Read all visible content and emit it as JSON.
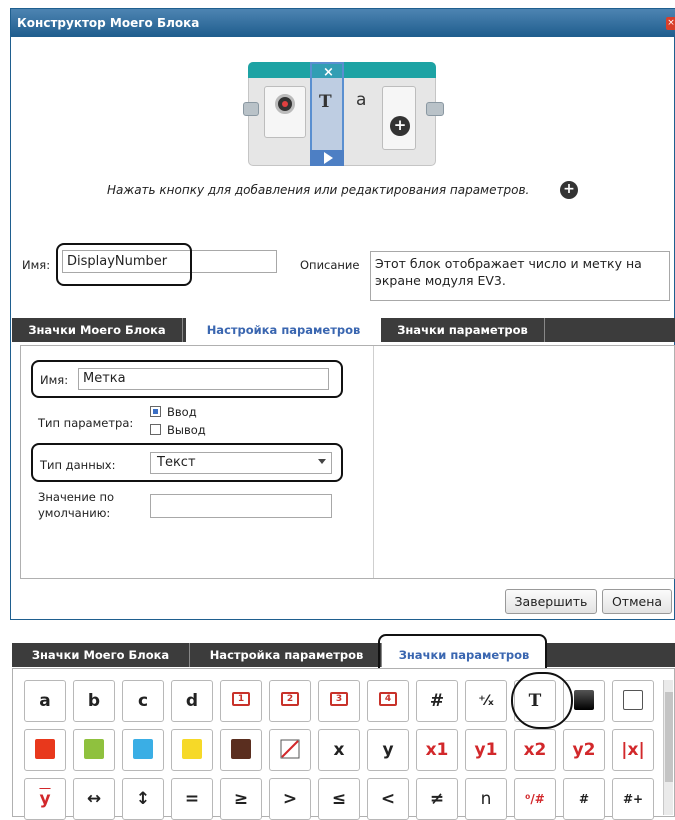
{
  "dialog": {
    "title": "Конструктор Моего Блока",
    "close_glyph": "×",
    "block": {
      "text_param": "T",
      "label_param": "a",
      "remove_glyph": "×",
      "add_glyph": "+"
    },
    "hint": "Нажать кнопку для добавления или редактирования параметров.",
    "hint_add_glyph": "+",
    "name_label": "Имя:",
    "name_value": "DisplayNumber",
    "desc_label": "Описание",
    "desc_value": "Этот блок отображает число и метку на экране модуля EV3.",
    "tabs": [
      {
        "label": "Значки Моего Блока"
      },
      {
        "label": "Настройка параметров"
      },
      {
        "label": "Значки параметров"
      }
    ],
    "settings": {
      "name_label": "Имя:",
      "name_value": "Метка",
      "type_label": "Тип параметра:",
      "type_input": "Ввод",
      "type_output": "Вывод",
      "datatype_label": "Тип данных:",
      "datatype_value": "Текст",
      "default_label_1": "Значение по",
      "default_label_2": "умолчанию:",
      "default_value": ""
    },
    "finish_button": "Завершить",
    "cancel_button": "Отмена"
  },
  "lower_tabs": [
    {
      "label": "Значки Моего Блока"
    },
    {
      "label": "Настройка параметров"
    },
    {
      "label": "Значки параметров"
    }
  ],
  "icon_grid": {
    "row1": [
      "a",
      "b",
      "c",
      "d",
      "1",
      "2",
      "3",
      "4",
      "#",
      "⁺⁄ₓ",
      "T",
      "",
      ""
    ],
    "row2_colors": [
      "#e8381c",
      "#8fc13e",
      "#3aaee5",
      "#f6d928",
      "#5a2e1f"
    ],
    "row2_text": [
      "x",
      "y",
      "x1",
      "y1",
      "x2",
      "y2",
      "|x|"
    ],
    "row3": [
      "y",
      "↔",
      "↕",
      "=",
      "≥",
      ">",
      "≤",
      "<",
      "≠",
      "n",
      "⁰/#",
      "#",
      "#+"
    ]
  },
  "colors": {
    "title_bar": "#2f6fa3",
    "tab_active_text": "#3a66b0",
    "accent_red": "#d2282b"
  }
}
